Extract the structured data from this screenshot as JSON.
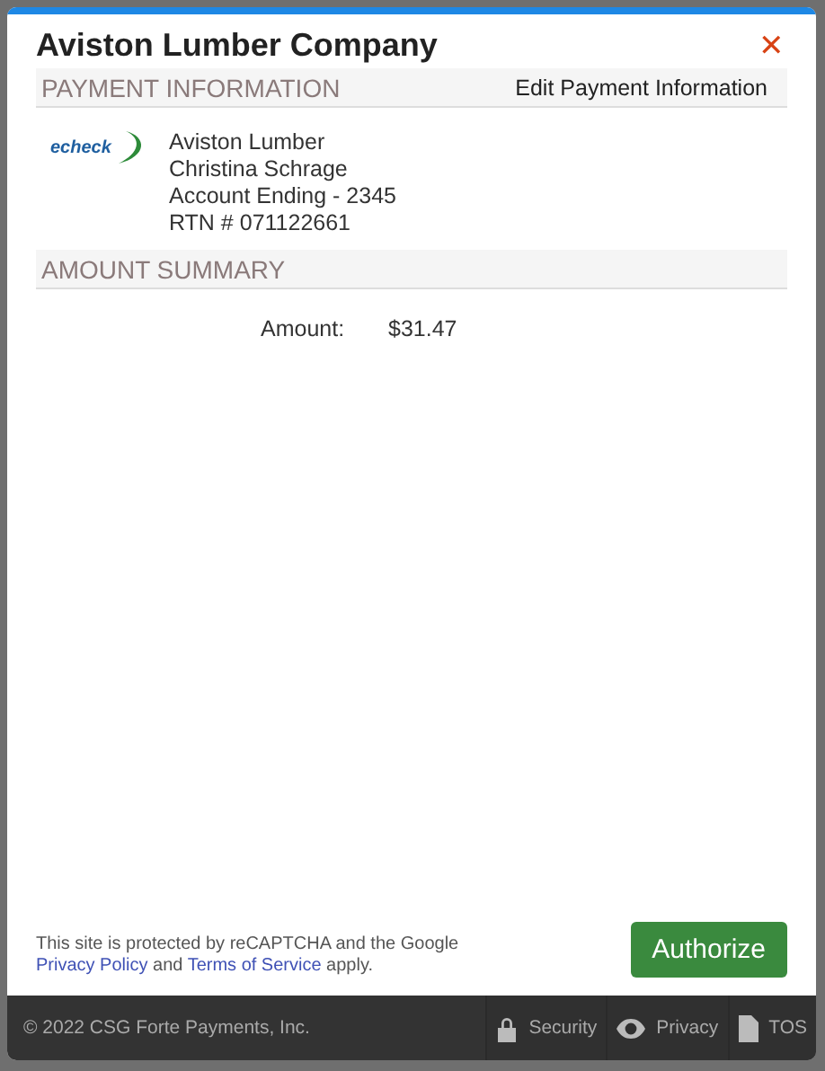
{
  "dialog": {
    "title": "Aviston Lumber Company",
    "close": "✕"
  },
  "payment": {
    "heading": "PAYMENT INFORMATION",
    "edit_link": "Edit Payment Information",
    "logo": "echeck",
    "lines": [
      "Aviston Lumber",
      "Christina Schrage",
      "Account Ending - 2345",
      "RTN # 071122661"
    ]
  },
  "summary": {
    "heading": "AMOUNT SUMMARY",
    "label": "Amount:",
    "value": "$31.47"
  },
  "recaptcha": {
    "before": "This site is protected by reCAPTCHA and the Google",
    "link1": "Privacy Policy",
    "middle": "and",
    "link2": "Terms of Service",
    "after": "apply."
  },
  "authorize_button": "Authorize",
  "footer": {
    "copyright": "© 2022 CSG Forte Payments, Inc.",
    "links": [
      {
        "kind": "lock",
        "label": "Security"
      },
      {
        "kind": "eye",
        "label": "Privacy"
      },
      {
        "kind": "file",
        "label": "TOS"
      }
    ]
  }
}
